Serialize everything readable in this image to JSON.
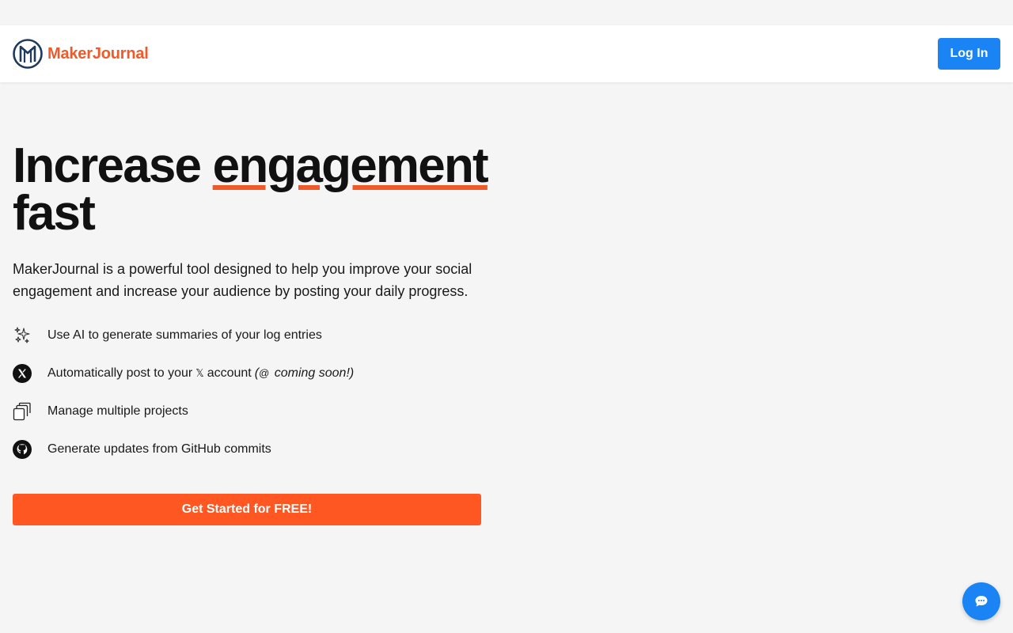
{
  "header": {
    "brand_name": "MakerJournal",
    "login_label": "Log In"
  },
  "hero": {
    "headline_before": "Increase ",
    "headline_highlight": "engagement",
    "headline_after": "fast",
    "subtitle": "MakerJournal is a powerful tool designed to help you improve your social engagement and increase your audience by posting your daily progress.",
    "features": [
      {
        "icon": "sparkles-icon",
        "text": "Use AI to generate summaries of your log entries"
      },
      {
        "icon": "x-logo-icon",
        "text_before": "Automatically post to your",
        "x_glyph": "𝕏",
        "text_after": "account",
        "threads_glyph": "@",
        "coming_soon": "coming soon!)",
        "paren_open": "("
      },
      {
        "icon": "stacked-cards-icon",
        "text": "Manage multiple projects"
      },
      {
        "icon": "github-icon",
        "text": "Generate updates from GitHub commits"
      }
    ],
    "cta_label": "Get Started for FREE!"
  },
  "colors": {
    "accent_orange": "#f05a28",
    "cta_orange": "#ff5722",
    "primary_blue": "#1a84f4",
    "logo_navy": "#1e3a5f"
  }
}
